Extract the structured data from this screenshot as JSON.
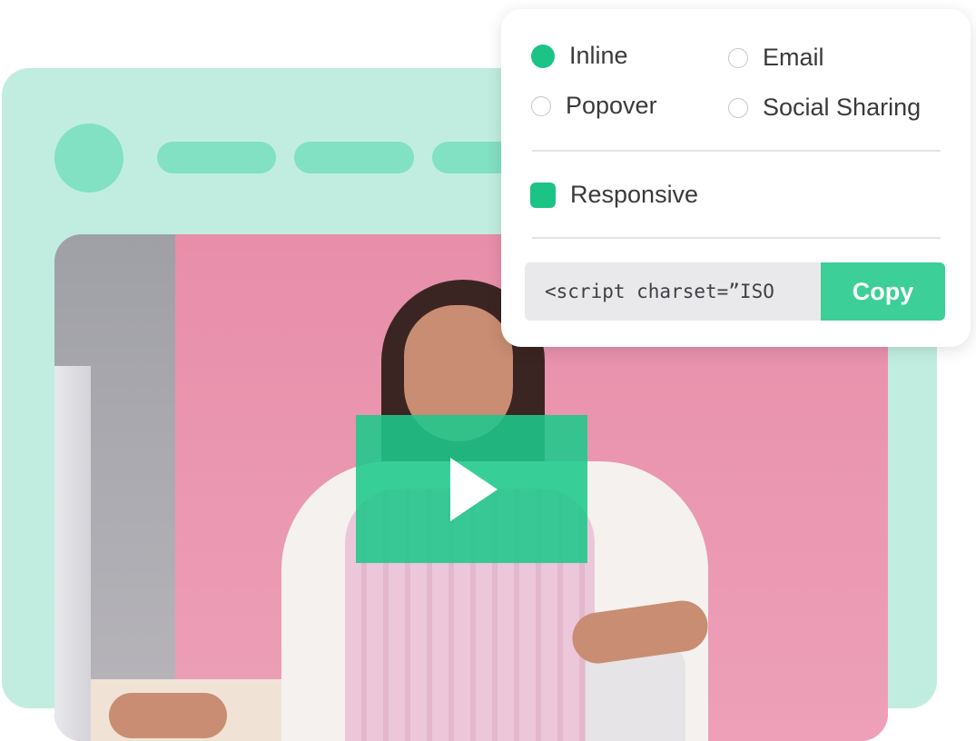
{
  "colors": {
    "accent": "#1bc387",
    "browser_background": "#c1ede0",
    "browser_placeholders": "#82e0c3",
    "copy_button": "#3dcf98"
  },
  "embed_options": {
    "types": [
      {
        "label": "Inline",
        "selected": true
      },
      {
        "label": "Email",
        "selected": false
      },
      {
        "label": "Popover",
        "selected": false
      },
      {
        "label": "Social Sharing",
        "selected": false
      }
    ],
    "responsive": {
      "label": "Responsive",
      "checked": true
    },
    "embed_code": "<script charset=”ISO",
    "copy_label": "Copy"
  },
  "video": {
    "play_icon": "play-icon"
  }
}
